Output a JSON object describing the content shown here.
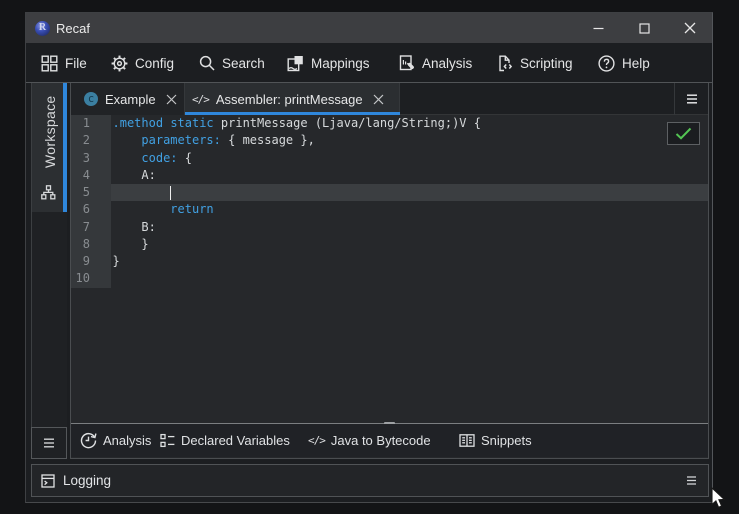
{
  "theme": {
    "outer": "#131416",
    "winbg": "#1c1e21",
    "titlebar": "#3d3e41",
    "accent": "#2f87dc",
    "kw": "#41a0e2",
    "plain": "#d6d9db",
    "editorbg": "#26282b",
    "gutterbg": "#35383b",
    "linehl": "#3b3e41",
    "tabbar": "#1d1f22",
    "classicon": "#3b7fa1",
    "green": "#53c553"
  },
  "window": {
    "title": "Recaf"
  },
  "menu": {
    "items": [
      {
        "label": "File"
      },
      {
        "label": "Config"
      },
      {
        "label": "Search"
      },
      {
        "label": "Mappings"
      },
      {
        "label": "Analysis"
      },
      {
        "label": "Scripting"
      },
      {
        "label": "Help"
      }
    ]
  },
  "sidebar": {
    "workspace_label": "Workspace"
  },
  "tabs": [
    {
      "label": "Example",
      "icon": "class"
    },
    {
      "label": "Assembler: printMessage",
      "icon": "code",
      "selected": true
    }
  ],
  "editor": {
    "line_numbers": [
      "1",
      "2",
      "3",
      "4",
      "5",
      "6",
      "7",
      "8",
      "9",
      "10"
    ],
    "cursor_line": 5,
    "lines": [
      {
        "tokens": [
          {
            "c": "kw",
            "t": ".method"
          },
          {
            "c": "pl",
            "t": " "
          },
          {
            "c": "kw",
            "t": "static"
          },
          {
            "c": "pl",
            "t": " printMessage (Ljava/lang/String;)V {"
          }
        ]
      },
      {
        "tokens": [
          {
            "c": "pl",
            "t": "    "
          },
          {
            "c": "kw",
            "t": "parameters:"
          },
          {
            "c": "pl",
            "t": " { message },"
          }
        ]
      },
      {
        "tokens": [
          {
            "c": "pl",
            "t": "    "
          },
          {
            "c": "kw",
            "t": "code:"
          },
          {
            "c": "pl",
            "t": " {"
          }
        ]
      },
      {
        "tokens": [
          {
            "c": "pl",
            "t": "    A:"
          }
        ]
      },
      {
        "tokens": [
          {
            "c": "pl",
            "t": ""
          }
        ]
      },
      {
        "tokens": [
          {
            "c": "pl",
            "t": "        "
          },
          {
            "c": "kw",
            "t": "return"
          }
        ]
      },
      {
        "tokens": [
          {
            "c": "pl",
            "t": "    B:"
          }
        ]
      },
      {
        "tokens": [
          {
            "c": "pl",
            "t": "    }"
          }
        ]
      },
      {
        "tokens": [
          {
            "c": "pl",
            "t": "}"
          }
        ]
      },
      {
        "tokens": [
          {
            "c": "pl",
            "t": ""
          }
        ]
      }
    ]
  },
  "assembler_toolbar": {
    "items": [
      {
        "label": "Analysis"
      },
      {
        "label": "Declared Variables"
      },
      {
        "label": "Java to Bytecode"
      },
      {
        "label": "Snippets"
      }
    ]
  },
  "logging": {
    "label": "Logging"
  }
}
